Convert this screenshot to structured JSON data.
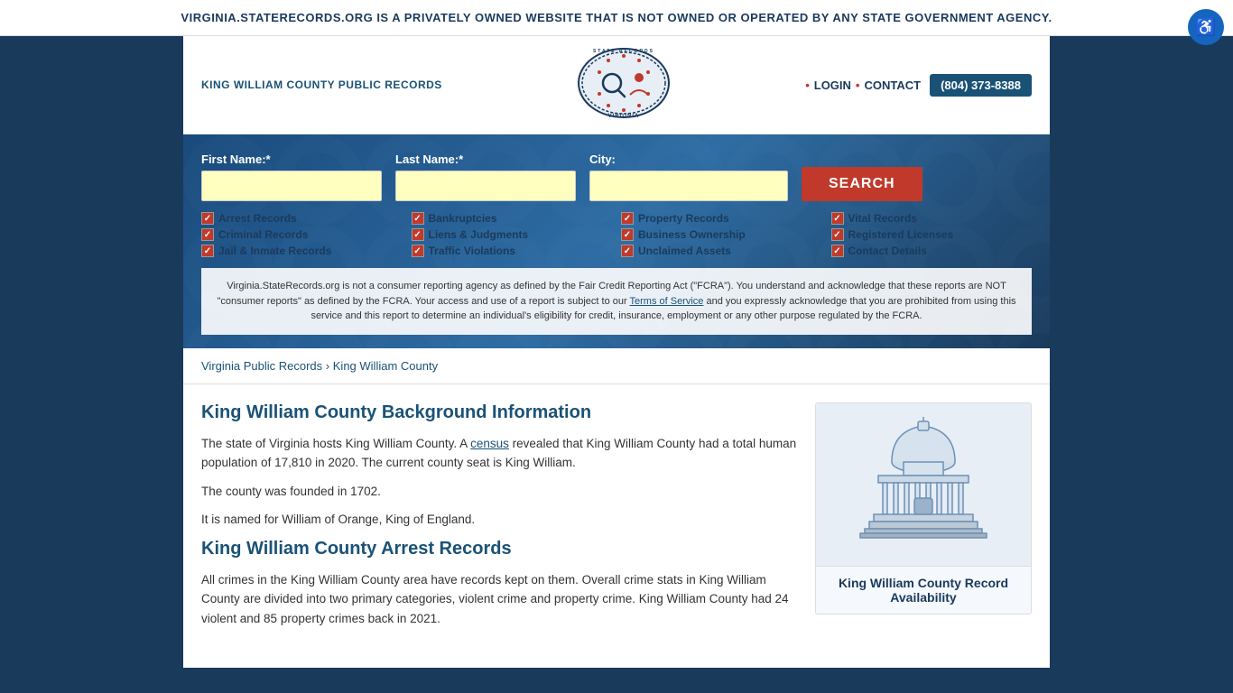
{
  "banner": {
    "text": "VIRGINIA.STATERECORDS.ORG IS A PRIVATELY OWNED WEBSITE THAT IS NOT OWNED OR OPERATED BY ANY STATE GOVERNMENT AGENCY.",
    "close_label": "×"
  },
  "header": {
    "site_title": "KING WILLIAM COUNTY PUBLIC RECORDS",
    "login_label": "LOGIN",
    "contact_label": "CONTACT",
    "phone": "(804) 373-8388",
    "logo_alt": "State Records Virginia"
  },
  "search": {
    "first_name_label": "First Name:*",
    "last_name_label": "Last Name:*",
    "city_label": "City:",
    "search_button": "SEARCH",
    "first_name_placeholder": "",
    "last_name_placeholder": "",
    "city_placeholder": ""
  },
  "checkboxes": [
    {
      "label": "Arrest Records",
      "checked": true
    },
    {
      "label": "Bankruptcies",
      "checked": true
    },
    {
      "label": "Property Records",
      "checked": true
    },
    {
      "label": "Vital Records",
      "checked": true
    },
    {
      "label": "Criminal Records",
      "checked": true
    },
    {
      "label": "Liens & Judgments",
      "checked": true
    },
    {
      "label": "Business Ownership",
      "checked": true
    },
    {
      "label": "Registered Licenses",
      "checked": true
    },
    {
      "label": "Jail & Inmate Records",
      "checked": true
    },
    {
      "label": "Traffic Violations",
      "checked": true
    },
    {
      "label": "Unclaimed Assets",
      "checked": true
    },
    {
      "label": "Contact Details",
      "checked": true
    }
  ],
  "disclaimer": {
    "text1": "Virginia.StateRecords.org is not a consumer reporting agency as defined by the Fair Credit Reporting Act (\"FCRA\"). You understand and acknowledge that these reports are NOT \"consumer reports\" as defined by the FCRA. Your access and use of a report is subject to our ",
    "tos_link": "Terms of Service",
    "text2": " and you expressly acknowledge that you are prohibited from using this service and this report to determine an individual's eligibility for credit, insurance, employment or any other purpose regulated by the FCRA."
  },
  "breadcrumb": {
    "link_label": "Virginia Public Records",
    "separator": "›",
    "current": "King William County"
  },
  "main_content": {
    "bg_title": "King William County Background Information",
    "bg_para1": "The state of Virginia hosts King William County. A census revealed that King William County had a total human population of 17,810 in 2020. The current county seat is King William.",
    "bg_para2": "The county was founded in 1702.",
    "bg_para3": "It is named for William of Orange, King of England.",
    "arrest_title": "King William County Arrest Records",
    "arrest_para": "All crimes in the King William County area have records kept on them. Overall crime stats in King William County are divided into two primary categories, violent crime and property crime. King William County had 24 violent and 85 property crimes back in 2021.",
    "census_link": "census"
  },
  "sidebar": {
    "card_title": "King William County Record Availability"
  },
  "accessibility_label": "♿"
}
